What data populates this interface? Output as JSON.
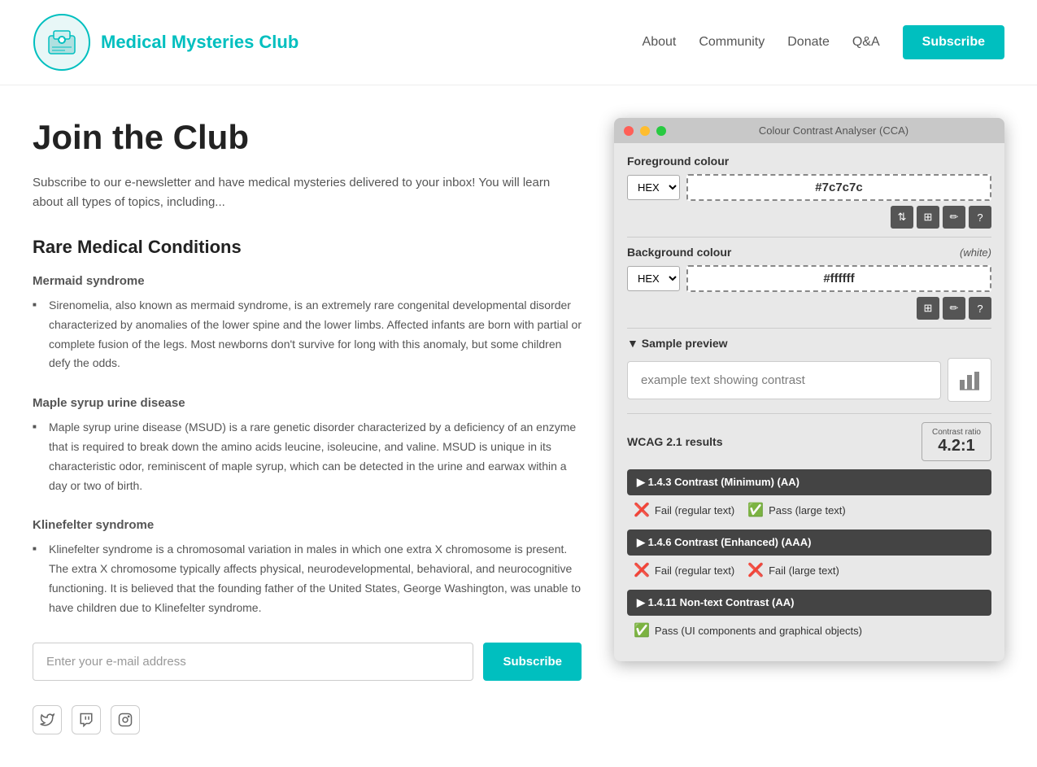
{
  "header": {
    "logo_alt": "Medical Mysteries Club logo",
    "title": "Medical Mysteries Club",
    "nav": {
      "about": "About",
      "community": "Community",
      "donate": "Donate",
      "qa": "Q&A",
      "subscribe": "Subscribe"
    }
  },
  "main": {
    "page_title": "Join the Club",
    "intro": "Subscribe to our e-newsletter and have medical mysteries delivered to your inbox! You will learn about all types of topics, including...",
    "section_title": "Rare Medical Conditions",
    "conditions": [
      {
        "title": "Mermaid syndrome",
        "desc": "Sirenomelia, also known as mermaid syndrome, is an extremely rare congenital developmental disorder characterized by anomalies of the lower spine and the lower limbs. Affected infants are born with partial or complete fusion of the legs. Most newborns don't survive for long with this anomaly, but some children defy the odds."
      },
      {
        "title": "Maple syrup urine disease",
        "desc": "Maple syrup urine disease (MSUD) is a rare genetic disorder characterized by a deficiency of an enzyme that is required to break down the amino acids leucine, isoleucine, and valine. MSUD is unique in its characteristic odor, reminiscent of maple syrup, which can be detected in the urine and earwax within a day or two of birth."
      },
      {
        "title": "Klinefelter syndrome",
        "desc": "Klinefelter syndrome is a chromosomal variation in males in which one extra X chromosome is present. The extra X chromosome typically affects physical, neurodevelopmental, behavioral, and neurocognitive functioning. It is believed that the founding father of the United States, George Washington, was unable to have children due to Klinefelter syndrome."
      }
    ],
    "email_placeholder": "Enter your e-mail address",
    "subscribe_label": "Subscribe"
  },
  "cca": {
    "title": "Colour Contrast Analyser (CCA)",
    "foreground_label": "Foreground colour",
    "fg_format": "HEX",
    "fg_value": "#7c7c7c",
    "background_label": "Background colour",
    "bg_white": "(white)",
    "bg_format": "HEX",
    "bg_value": "#ffffff",
    "sample_preview_label": "▼ Sample preview",
    "sample_text": "example text showing contrast",
    "wcag_label": "WCAG 2.1 results",
    "contrast_ratio_label": "Contrast ratio",
    "contrast_ratio_value": "4.2:1",
    "criteria": [
      {
        "label": "▶  1.4.3 Contrast (Minimum) (AA)",
        "results": [
          {
            "pass": false,
            "text": "Fail (regular text)"
          },
          {
            "pass": true,
            "text": "Pass (large text)"
          }
        ]
      },
      {
        "label": "▶  1.4.6 Contrast (Enhanced) (AAA)",
        "results": [
          {
            "pass": false,
            "text": "Fail (regular text)"
          },
          {
            "pass": false,
            "text": "Fail (large text)"
          }
        ]
      },
      {
        "label": "▶  1.4.11 Non-text Contrast (AA)",
        "results": [
          {
            "pass": true,
            "text": "Pass (UI components and graphical objects)"
          }
        ]
      }
    ]
  }
}
